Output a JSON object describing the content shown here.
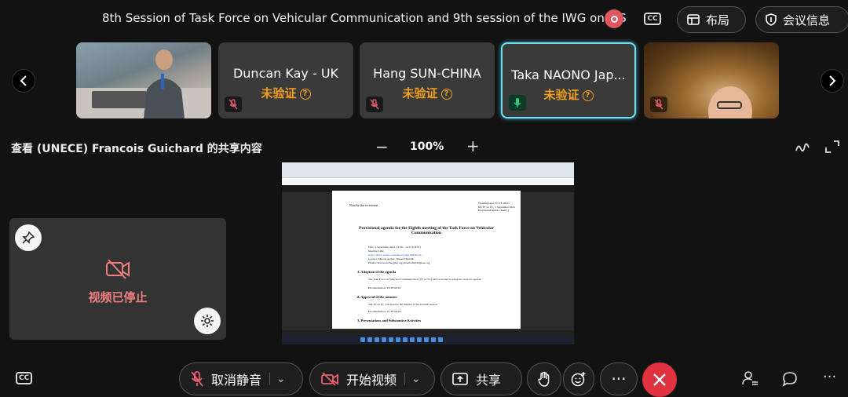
{
  "header": {
    "meeting_title": "8th Session of Task Force on Vehicular Communication and 9th session of the IWG on ITS",
    "layout_label": "布局",
    "meeting_info_label": "会议信息"
  },
  "participants": [
    {
      "name": "",
      "has_video": true
    },
    {
      "name": "Duncan Kay - UK",
      "status": "未验证",
      "muted": true
    },
    {
      "name": "Hang SUN-CHINA",
      "status": "未验证",
      "muted": true
    },
    {
      "name": "Taka NAONO Jap...",
      "status": "未验证",
      "muted": false,
      "active_speaker": true
    },
    {
      "name": "",
      "has_video": true
    }
  ],
  "share": {
    "title": "查看 (UNECE) Francois Guichard 的共享内容",
    "zoom_minus": "−",
    "zoom_level": "100%",
    "zoom_plus": "+"
  },
  "shared_document": {
    "meta_left": "Note by the secretariat",
    "meta_right": [
      "Working paper VCTF-08-01",
      "8th TF on VC, 5 September 2024",
      "Provisional agenda (Item 1)"
    ],
    "heading": "Provisional agenda for the Eighth meeting of the Task Force on Vehicular Communication",
    "lines": [
      "Date:            5 September 2024, 12:30 – 14:15 (CEST)",
      "Meeting Link:",
      "https://unece.webex.com/unece/j.php?MTID=m...",
      "Contact:         Marcus Archer / Russell Shields",
      "Emails:          marcus.archer@un.org  russell.shields@ieee.org"
    ],
    "sections": [
      {
        "title": "1.    Adoption of the agenda",
        "text": "The Task Force on Vehicular Communication (TF on VC) will be invited to adopt the session's agenda.",
        "doc": "Documentation:       VCTF-08-01"
      },
      {
        "title": "2.    Approval of the minutes",
        "text": "The TF on VC will approve the minutes of the seventh session.",
        "doc": "Documentation:       VCTF-08-02"
      },
      {
        "title": "3.    Presentations and Substantive Activities",
        "text": "",
        "doc": ""
      }
    ]
  },
  "self_view": {
    "video_stopped_label": "视频已停止"
  },
  "controls": {
    "unmute_label": "取消静音",
    "start_video_label": "开始视频",
    "share_label": "共享",
    "more_label": "···"
  }
}
